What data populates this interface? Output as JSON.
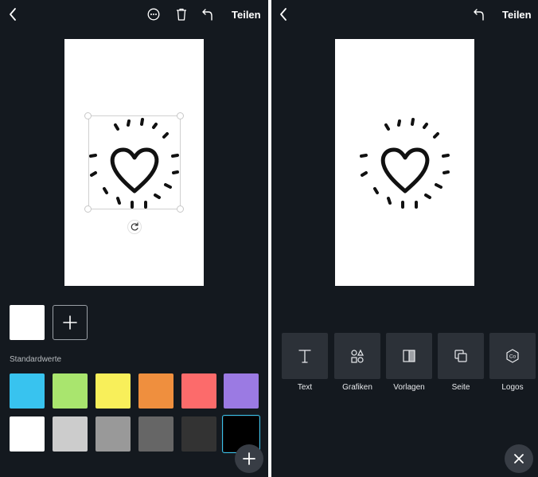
{
  "left_screen": {
    "header": {
      "share_label": "Teilen"
    },
    "palette": {
      "standard_label": "Standardwerte",
      "current_color": "#ffffff",
      "colors_row1": [
        "#38c3ef",
        "#a9e56e",
        "#f8ef5a",
        "#ef8f3e",
        "#fc6b6b",
        "#9b7ae3"
      ],
      "colors_row2": [
        "#ffffff",
        "#cccccc",
        "#999999",
        "#666666",
        "#333333",
        "#000000"
      ],
      "selected_color": "#000000"
    }
  },
  "right_screen": {
    "header": {
      "share_label": "Teilen"
    },
    "tools": [
      {
        "label": "Text",
        "icon": "text-icon"
      },
      {
        "label": "Grafiken",
        "icon": "shapes-icon"
      },
      {
        "label": "Vorlagen",
        "icon": "layout-icon"
      },
      {
        "label": "Seite",
        "icon": "pages-icon"
      },
      {
        "label": "Logos",
        "icon": "logo-icon"
      }
    ]
  },
  "colors": {
    "background": "#14191f",
    "tool_tile": "#2c3138",
    "fab": "#383d45",
    "accent": "#38c3ea"
  }
}
